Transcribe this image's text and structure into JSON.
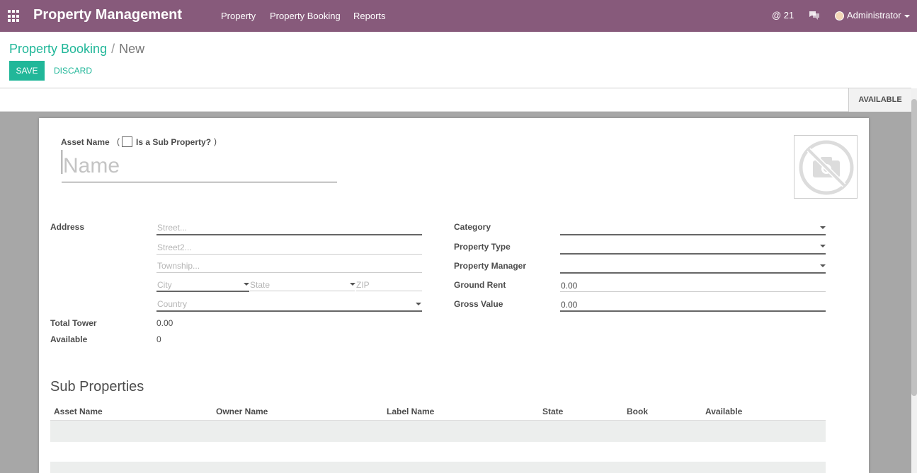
{
  "navbar": {
    "brand": "Property Management",
    "menu": [
      "Property",
      "Property Booking",
      "Reports"
    ],
    "mentions_count": "@ 21",
    "user": "Administrator"
  },
  "breadcrumb": {
    "parent": "Property Booking",
    "separator": "/",
    "current": "New"
  },
  "buttons": {
    "save": "SAVE",
    "discard": "DISCARD"
  },
  "status": {
    "available": "AVAILABLE"
  },
  "form": {
    "asset_name_label": "Asset Name",
    "sub_property_open": "(",
    "sub_property_label": "Is a Sub Property?",
    "sub_property_close": ")",
    "name_placeholder": "Name",
    "address_label": "Address",
    "street_ph": "Street...",
    "street2_ph": "Street2...",
    "township_ph": "Township...",
    "city_ph": "City",
    "state_ph": "State",
    "zip_ph": "ZIP",
    "country_ph": "Country",
    "total_tower_label": "Total Tower",
    "total_tower_value": "0.00",
    "available_label": "Available",
    "available_value": "0",
    "category_label": "Category",
    "property_type_label": "Property Type",
    "property_manager_label": "Property Manager",
    "ground_rent_label": "Ground Rent",
    "ground_rent_value": "0.00",
    "gross_value_label": "Gross Value",
    "gross_value_value": "0.00"
  },
  "sub_properties": {
    "title": "Sub Properties",
    "columns": [
      "Asset Name",
      "Owner Name",
      "Label Name",
      "State",
      "Book",
      "Available"
    ]
  },
  "colors": {
    "navbar": "#875a7b",
    "accent": "#21b799"
  },
  "icons": [
    "apps-grid-icon",
    "chat-icon",
    "user-avatar-icon",
    "no-camera-icon"
  ]
}
